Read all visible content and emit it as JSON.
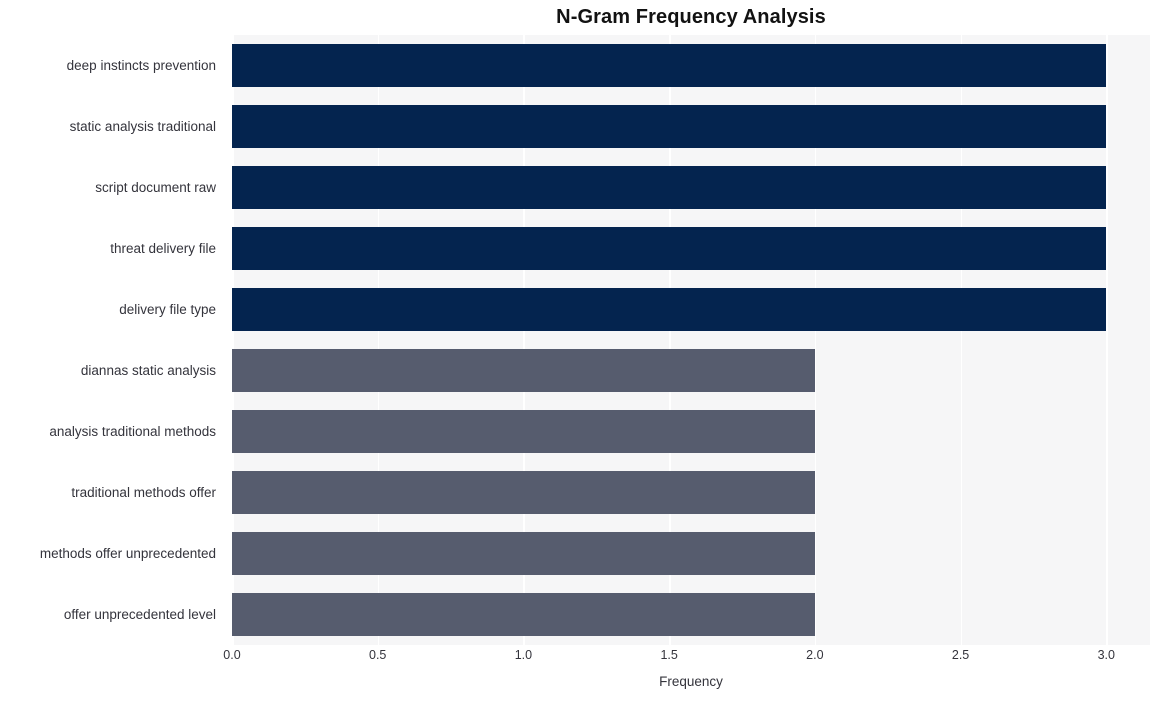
{
  "chart_data": {
    "type": "bar",
    "orientation": "horizontal",
    "title": "N-Gram Frequency Analysis",
    "xlabel": "Frequency",
    "ylabel": "",
    "xlim": [
      0,
      3.15
    ],
    "ylim": [
      0,
      10
    ],
    "grid": true,
    "grid_axis": "x",
    "legend": null,
    "categories": [
      "deep instincts prevention",
      "static analysis traditional",
      "script document raw",
      "threat delivery file",
      "delivery file type",
      "diannas static analysis",
      "analysis traditional methods",
      "traditional methods offer",
      "methods offer unprecedented",
      "offer unprecedented level"
    ],
    "values": [
      3,
      3,
      3,
      3,
      3,
      2,
      2,
      2,
      2,
      2
    ],
    "bar_colors": [
      "#04244f",
      "#04244f",
      "#04244f",
      "#04244f",
      "#04244f",
      "#565c6e",
      "#565c6e",
      "#565c6e",
      "#565c6e",
      "#565c6e"
    ],
    "xticks": [
      0.0,
      0.5,
      1.0,
      1.5,
      2.0,
      2.5,
      3.0
    ],
    "xtick_labels": [
      "0.0",
      "0.5",
      "1.0",
      "1.5",
      "2.0",
      "2.5",
      "3.0"
    ],
    "plot_background": "#f6f6f7",
    "figure_background": "#ffffff",
    "gridline_color": "#ffffff",
    "tick_label_color": "#34343c",
    "title_color": "#121212"
  }
}
